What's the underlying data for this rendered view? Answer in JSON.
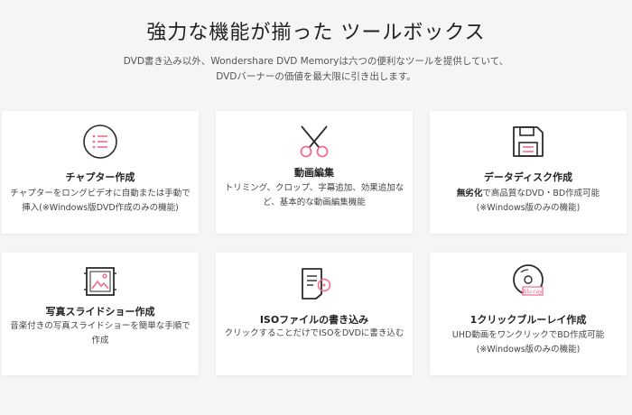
{
  "header": {
    "title": "強力な機能が揃った ツールボックス",
    "subtitle_line1": "DVD書き込み以外、Wondershare DVD Memoryは六つの便利なツールを提供していて、",
    "subtitle_line2": "DVDバーナーの価値を最大限に引き出します。"
  },
  "colors": {
    "accent_pink": "#f06a8c",
    "icon_dark": "#2b2b2b",
    "card_bg": "#ffffff",
    "page_bg": "#f5f5f5"
  },
  "cards": [
    {
      "icon": "chapter-list-icon",
      "title": "チャプター作成",
      "desc_line1": "チャプターをロングビデオに自動または手動で",
      "desc_line2": "挿入(※Windows版DVD作成のみの機能)"
    },
    {
      "icon": "scissors-icon",
      "title": "動画編集",
      "desc_line1": "トリミング、クロップ、字幕追加、効果追加な",
      "desc_line2": "ど、基本的な動画編集機能"
    },
    {
      "icon": "floppy-disk-icon",
      "title": "データディスク作成",
      "desc_bold": "無劣化",
      "desc_line1_rest": "で高品質なDVD・BD作成可能",
      "desc_line2": "(※Windows版のみの機能)"
    },
    {
      "icon": "photo-slideshow-icon",
      "title": "写真スライドショー作成",
      "desc_line1": "音楽付きの写真スライドショーを簡単な手順で",
      "desc_line2": "作成"
    },
    {
      "icon": "iso-file-icon",
      "title": "ISOファイルの書き込み",
      "desc_line1": "クリックすることだけでISOをDVDに書き込む"
    },
    {
      "icon": "bluray-disc-icon",
      "title": "1クリックブルーレイ作成",
      "desc_line1": "UHD動画をワンクリックでBD作成可能",
      "desc_line2": "(※Windows版のみの機能)",
      "disc_badge": "Blu-ray"
    }
  ]
}
